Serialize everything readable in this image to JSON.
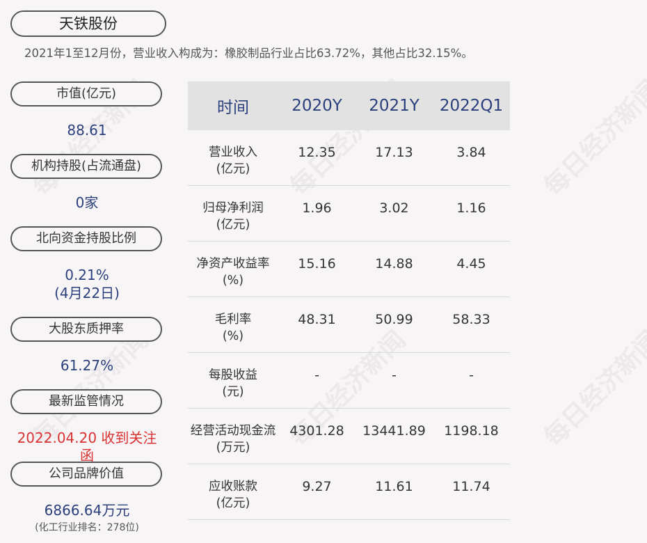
{
  "title": "天铁股份",
  "summary": "2021年1至12月份，营业收入构成为：橡胶制品行业占比63.72%，其他占比32.15%。",
  "watermark": "每日经济新闻",
  "left": {
    "market_cap_label": "市值(亿元)",
    "market_cap_value": "88.61",
    "institution_label": "机构持股(占流通盘)",
    "institution_value": "0家",
    "northbound_label": "北向资金持股比例",
    "northbound_value": "0.21%",
    "northbound_date": "(4月22日)",
    "pledge_label": "大股东质押率",
    "pledge_value": "61.27%",
    "regulation_label": "最新监管情况",
    "regulation_value": "2022.04.20 收到关注函",
    "brand_label": "公司品牌价值",
    "brand_value": "6866.64万元",
    "brand_rank": "(化工行业排名：278位)"
  },
  "table": {
    "headers": [
      "时间",
      "2020Y",
      "2021Y",
      "2022Q1"
    ],
    "rows": [
      {
        "label1": "营业收入",
        "label2": "(亿元)",
        "v": [
          "12.35",
          "17.13",
          "3.84"
        ]
      },
      {
        "label1": "归母净利润",
        "label2": "(亿元)",
        "v": [
          "1.96",
          "3.02",
          "1.16"
        ]
      },
      {
        "label1": "净资产收益率",
        "label2": "(%)",
        "v": [
          "15.16",
          "14.88",
          "4.45"
        ]
      },
      {
        "label1": "毛利率",
        "label2": "(%)",
        "v": [
          "48.31",
          "50.99",
          "58.33"
        ]
      },
      {
        "label1": "每股收益",
        "label2": "(元)",
        "v": [
          "-",
          "-",
          "-"
        ]
      },
      {
        "label1": "经营活动现金流",
        "label2": "(万元)",
        "v": [
          "4301.28",
          "13441.89",
          "1198.18"
        ]
      },
      {
        "label1": "应收账款",
        "label2": "(亿元)",
        "v": [
          "9.27",
          "11.61",
          "11.74"
        ]
      }
    ]
  }
}
